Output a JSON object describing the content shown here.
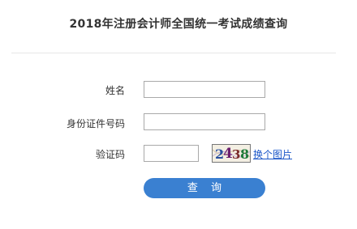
{
  "page": {
    "title": "2018年注册会计师全国统一考试成绩查询"
  },
  "form": {
    "name_label": "姓名",
    "name_value": "",
    "id_label": "身份证件号码",
    "id_value": "",
    "captcha_label": "验证码",
    "captcha_value": "",
    "captcha_image_text": "2438",
    "change_image_link": "换个图片",
    "query_button": "查 询"
  },
  "colors": {
    "accent": "#3a80d1",
    "link": "#1a56c8",
    "title_text": "#333333"
  }
}
